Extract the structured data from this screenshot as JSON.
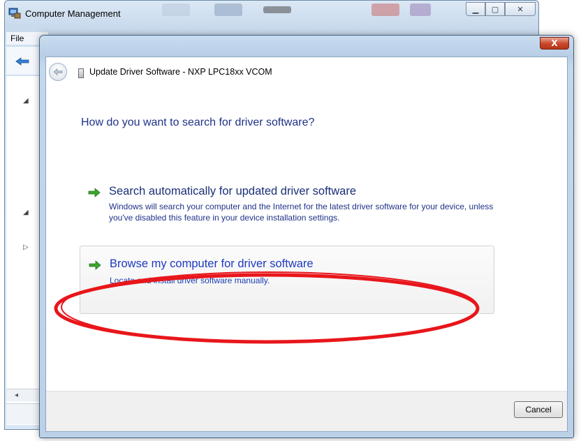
{
  "background_window": {
    "title": "Computer Management",
    "menu_label": "File"
  },
  "dialog": {
    "close_glyph": "X",
    "header_title": "Update Driver Software - NXP LPC18xx VCOM",
    "question": "How do you want to search for driver software?",
    "options": [
      {
        "title": "Search automatically for updated driver software",
        "description": "Windows will search your computer and the Internet for the latest driver software for your device, unless you've disabled this feature in your device installation settings."
      },
      {
        "title": "Browse my computer for driver software",
        "description": "Locate and install driver software manually."
      }
    ],
    "cancel_label": "Cancel"
  },
  "colors": {
    "highlight_ring": "#e8161b",
    "arrow_green": "#3aa62c",
    "link_blue": "#1e3ac2"
  },
  "icons": [
    "computer-management-icon",
    "back-arrow-icon",
    "device-icon",
    "green-arrow-icon",
    "close-icon"
  ]
}
